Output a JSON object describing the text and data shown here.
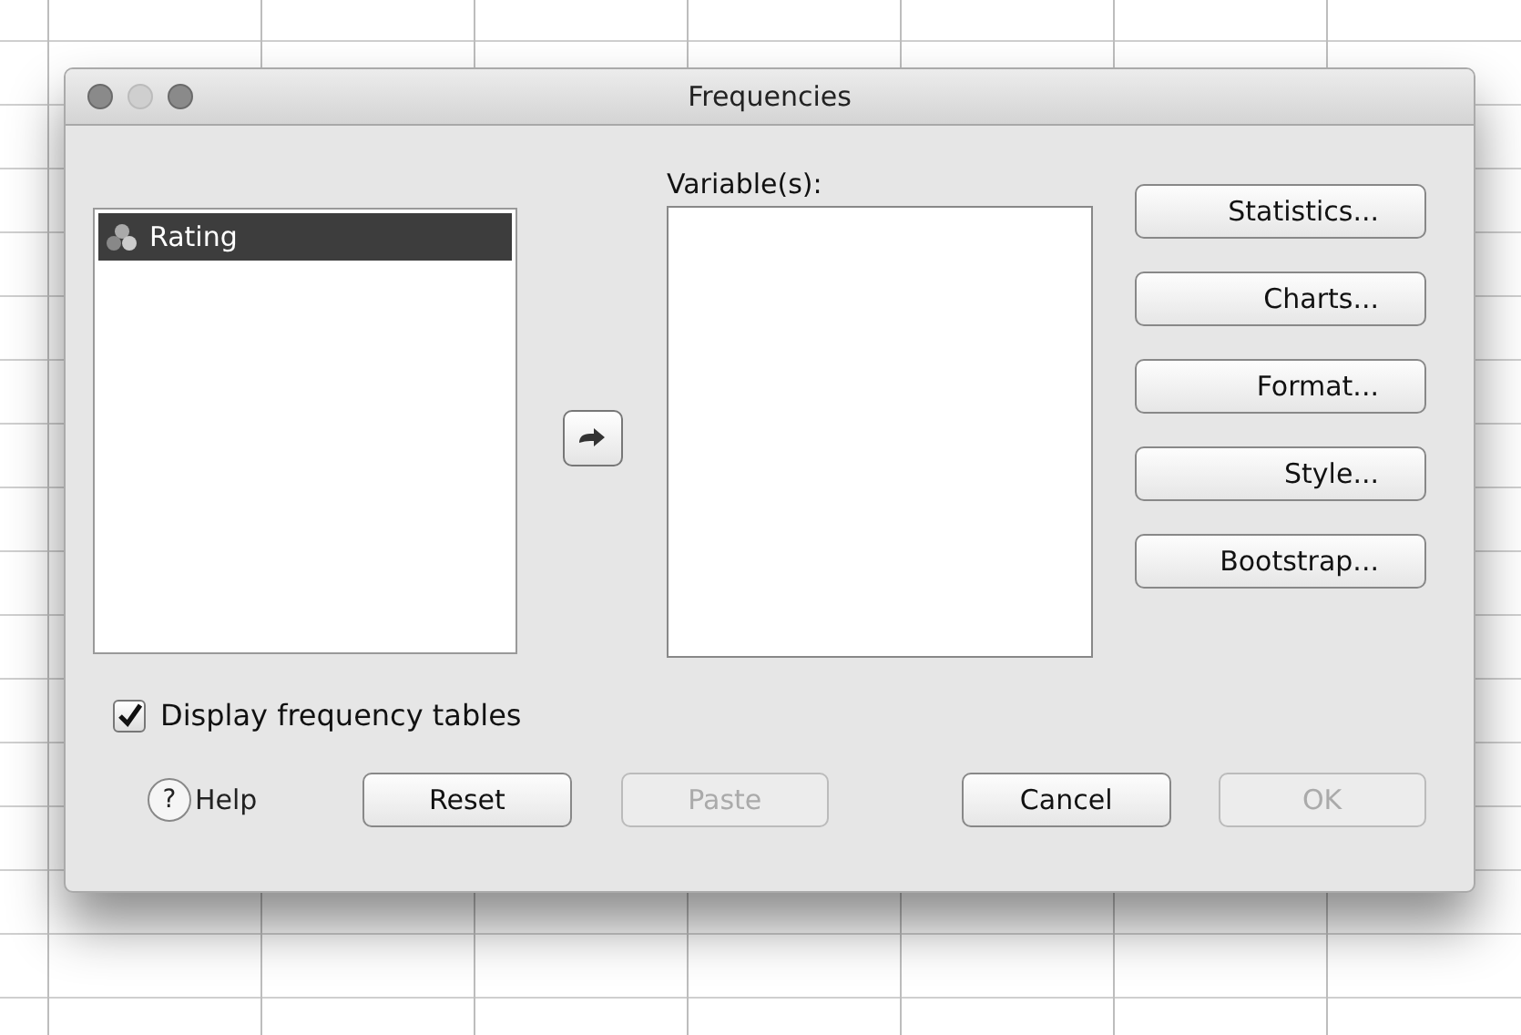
{
  "window": {
    "title": "Frequencies"
  },
  "source_list": {
    "items": [
      {
        "label": "Rating",
        "selected": true
      }
    ]
  },
  "target_list": {
    "label": "Variable(s):"
  },
  "side_buttons": [
    {
      "label": "Statistics..."
    },
    {
      "label": "Charts..."
    },
    {
      "label": "Format..."
    },
    {
      "label": "Style..."
    },
    {
      "label": "Bootstrap..."
    }
  ],
  "checkbox": {
    "label": "Display frequency tables",
    "checked": true
  },
  "bottom_buttons": [
    {
      "kind": "help",
      "label": "Help",
      "icon": "?",
      "disabled": false
    },
    {
      "kind": "push",
      "label": "Reset",
      "disabled": false
    },
    {
      "kind": "push",
      "label": "Paste",
      "disabled": true
    },
    {
      "kind": "push",
      "label": "Cancel",
      "disabled": false
    },
    {
      "kind": "push",
      "label": "OK",
      "disabled": true
    }
  ]
}
